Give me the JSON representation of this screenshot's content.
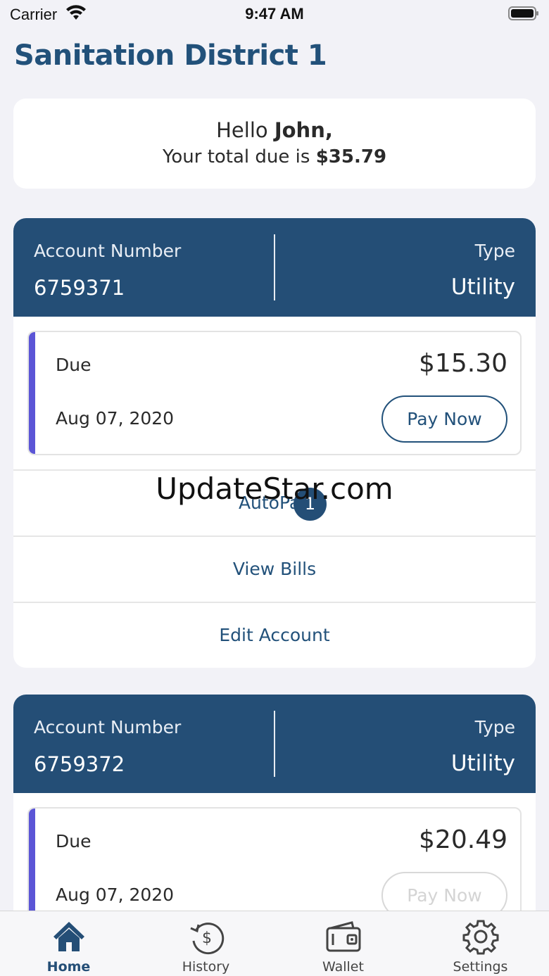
{
  "status_bar": {
    "carrier": "Carrier",
    "time": "9:47 AM"
  },
  "header": {
    "title": "Sanitation District 1"
  },
  "greeting": {
    "hello": "Hello",
    "name": "John,",
    "due_prefix": "Your total due is",
    "total_due": "$35.79"
  },
  "accounts": [
    {
      "account_label": "Account Number",
      "account_number": "6759371",
      "type_label": "Type",
      "type_value": "Utility",
      "due_label": "Due",
      "due_date": "Aug 07, 2020",
      "amount": "$15.30",
      "pay_button": "Pay Now",
      "autopay_label": "AutoPay",
      "autopay_badge": "1",
      "view_bills_label": "View Bills",
      "edit_account_label": "Edit Account"
    },
    {
      "account_label": "Account Number",
      "account_number": "6759372",
      "type_label": "Type",
      "type_value": "Utility",
      "due_label": "Due",
      "due_date": "Aug 07, 2020",
      "amount": "$20.49",
      "pay_button": "Pay Now"
    }
  ],
  "watermark": "UpdateStar.com",
  "tab_bar": {
    "items": [
      {
        "label": "Home",
        "icon": "home-icon",
        "active": true
      },
      {
        "label": "History",
        "icon": "history-icon",
        "active": false
      },
      {
        "label": "Wallet",
        "icon": "wallet-icon",
        "active": false
      },
      {
        "label": "Settings",
        "icon": "settings-icon",
        "active": false
      }
    ]
  },
  "colors": {
    "brand": "#22517a",
    "header_bg": "#244e76",
    "due_accent": "#5b55d6",
    "page_bg": "#f2f2f7"
  }
}
